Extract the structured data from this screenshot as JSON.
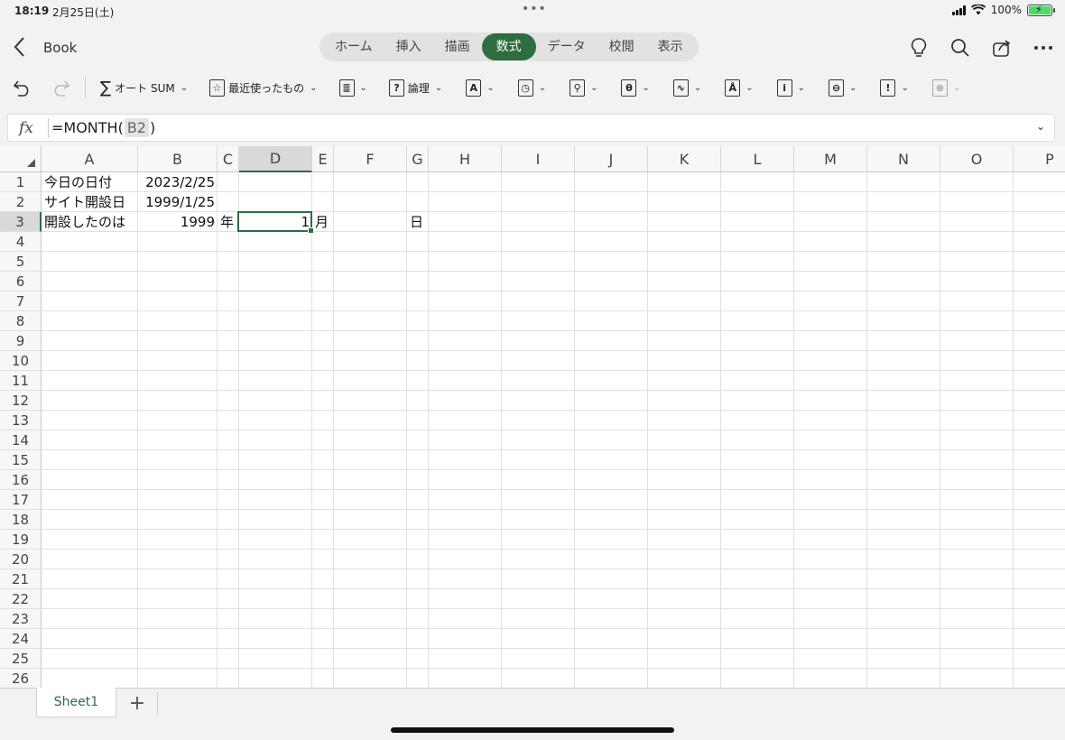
{
  "status": {
    "time": "18:19",
    "date": "2月25日(土)",
    "battery": "100%"
  },
  "header": {
    "title": "Book",
    "tabs": [
      "ホーム",
      "挿入",
      "描画",
      "数式",
      "データ",
      "校閲",
      "表示"
    ],
    "active_tab": "数式"
  },
  "ribbon": {
    "autosum": "オート SUM",
    "recent": "最近使ったもの",
    "logic": "論理"
  },
  "formula": {
    "prefix": "=MONTH(",
    "ref": "B2",
    "suffix": ")"
  },
  "grid": {
    "columns": [
      "A",
      "B",
      "C",
      "D",
      "E",
      "F",
      "G",
      "H",
      "I",
      "J",
      "K",
      "L",
      "M",
      "N",
      "O",
      "P"
    ],
    "rows": [
      "1",
      "2",
      "3",
      "4",
      "5",
      "6",
      "7",
      "8",
      "9",
      "10",
      "11",
      "12",
      "13",
      "14",
      "15",
      "16",
      "17",
      "18",
      "19",
      "20",
      "21",
      "22",
      "23",
      "24",
      "25",
      "26"
    ],
    "selected_column": "D",
    "selected_row": "3",
    "cells": {
      "A1": "今日の日付",
      "B1": "2023/2/25",
      "A2": "サイト開設日",
      "B2": "1999/1/25",
      "A3": "開設したのは",
      "B3": "1999",
      "C3": "年",
      "D3": "1",
      "E3": "月",
      "G3": "日"
    }
  },
  "sheets": {
    "tab1": "Sheet1",
    "add": "+"
  },
  "colors": {
    "accent": "#2e6d3f"
  }
}
